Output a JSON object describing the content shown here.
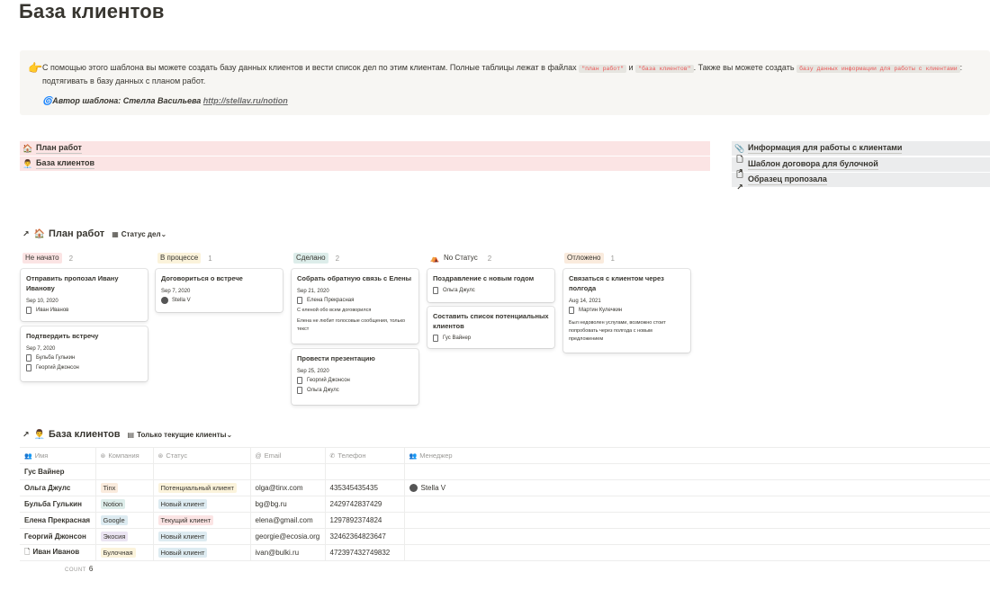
{
  "page": {
    "title": "База клиентов"
  },
  "callout": {
    "emoji": "👉",
    "text_1": "С помощью этого шаблона вы можете создать базу данных клиентов и вести список дел по этим клиентам. Полные таблицы лежат в файлах",
    "code_1": "\"план работ\"",
    "text_and": "и",
    "code_2": "\"база клиентов\"",
    "text_2": ". Также вы можете создать",
    "code_3": "базу данных информации для работы с клиентами",
    "text_3": ": подтягивать в базу данных с планом работ.",
    "author_emoji": "🌀",
    "author_label": "Автор шаблона: Стелла Васильева",
    "author_link": "http://stellav.ru/notion"
  },
  "links_left": [
    {
      "icon": "🏠",
      "label": "План работ"
    },
    {
      "icon": "👨‍💼",
      "label": "База клиентов"
    }
  ],
  "links_right": [
    {
      "icon": "📎",
      "label": "Информация для работы с клиентами"
    },
    {
      "icon": "🗋↗",
      "label": "Шаблон договора для булочной"
    },
    {
      "icon": "🗋↗",
      "label": "Образец пропозала"
    }
  ],
  "board": {
    "arrow": "↗",
    "emoji": "🏠",
    "title": "План работ",
    "view_icon": "▦",
    "view": "Статус дел",
    "view_chevron": "⌄",
    "columns": [
      {
        "label": "Не начато",
        "count": "2",
        "color": "#fbe4e4"
      },
      {
        "label": "В процессе",
        "count": "1",
        "color": "#fbf3db"
      },
      {
        "label": "Сделано",
        "count": "2",
        "color": "#ddedea"
      },
      {
        "label": "No Статус",
        "count": "2",
        "color": "transparent",
        "icon": "⛺"
      },
      {
        "label": "Отложено",
        "count": "1",
        "color": "#faebdd"
      }
    ],
    "cards": [
      {
        "title": "Отправить пропозал Ивану Иванову",
        "date": "Sep 10, 2020",
        "rels": [
          "Иван Иванов"
        ]
      },
      {
        "title": "Подтвердить встречу",
        "date": "Sep 7, 2020",
        "rels": [
          "Бульба Гулькин",
          "Георгий Джонсон"
        ]
      },
      {
        "title": "Договориться о встрече",
        "date": "Sep 7, 2020",
        "person": "Stella V"
      },
      {
        "title": "Собрать обратную связь с Елены",
        "date": "Sep 21, 2020",
        "rels": [
          "Елена Прекрасная"
        ],
        "notes": [
          "С еленой обо всем договорился",
          "Елена не любит голосовые сообщения, только текст"
        ]
      },
      {
        "title": "Провести презентацию",
        "date": "Sep 25, 2020",
        "rels": [
          "Георгий Джонсон",
          "Ольга Джулс"
        ]
      },
      {
        "title": "Поздравление с новым годом",
        "rels": [
          "Ольга Джулс"
        ]
      },
      {
        "title": "Составить список потенциальных клиентов",
        "rels": [
          "Гус Вайнер"
        ]
      },
      {
        "title": "Связаться с клиентом через полгода",
        "date": "Aug 14, 2021",
        "rels": [
          "Мартин Кулечкин"
        ],
        "notes": [
          "Был недоволен услугами, возможно стоит попробовать через полгода с новым предложением"
        ]
      }
    ]
  },
  "clients": {
    "arrow": "↗",
    "emoji": "👨‍💼",
    "title": "База клиентов",
    "view_icon": "▤",
    "view": "Только текущие клиенты",
    "view_chevron": "⌄",
    "headers": [
      {
        "icon": "👥",
        "label": "Имя"
      },
      {
        "icon": "⊛",
        "label": "Компания"
      },
      {
        "icon": "⊛",
        "label": "Статус"
      },
      {
        "icon": "@",
        "label": "Email"
      },
      {
        "icon": "✆",
        "label": "Телефон"
      },
      {
        "icon": "👥",
        "label": "Менеджер"
      }
    ],
    "rows": [
      {
        "name": "Гус Вайнер",
        "company": "",
        "status": "",
        "email": "",
        "phone": "",
        "manager": ""
      },
      {
        "name": "Ольга Джулс",
        "company": "Tinx",
        "company_color": "#faebdd",
        "status": "Потенциальный клиент",
        "status_color": "#fbf3db",
        "email": "olga@tinx.com",
        "phone": "435345435435",
        "manager": "Stella V"
      },
      {
        "name": "Бульба Гулькин",
        "company": "Notion",
        "company_color": "#ddedea",
        "status": "Новый клиент",
        "status_color": "#ddebf1",
        "email": "bg@bg.ru",
        "phone": "2429742837429",
        "manager": ""
      },
      {
        "name": "Елена Прекрасная",
        "company": "Google",
        "company_color": "#ddebf1",
        "status": "Текущий клиент",
        "status_color": "#fbe4e4",
        "email": "elena@gmail.com",
        "phone": "1297892374824",
        "manager": ""
      },
      {
        "name": "Георгий Джонсон",
        "company": "Экосия",
        "company_color": "#eae4f2",
        "status": "Новый клиент",
        "status_color": "#ddebf1",
        "email": "georgie@ecosia.org",
        "phone": "32462364823647",
        "manager": ""
      },
      {
        "name": "Иван Иванов",
        "name_icon": "🗋",
        "company": "Булочная",
        "company_color": "#fbf3db",
        "status": "Новый клиент",
        "status_color": "#ddebf1",
        "email": "ivan@bulki.ru",
        "phone": "472397432749832",
        "manager": ""
      }
    ],
    "count_label": "COUNT",
    "count": "6"
  }
}
